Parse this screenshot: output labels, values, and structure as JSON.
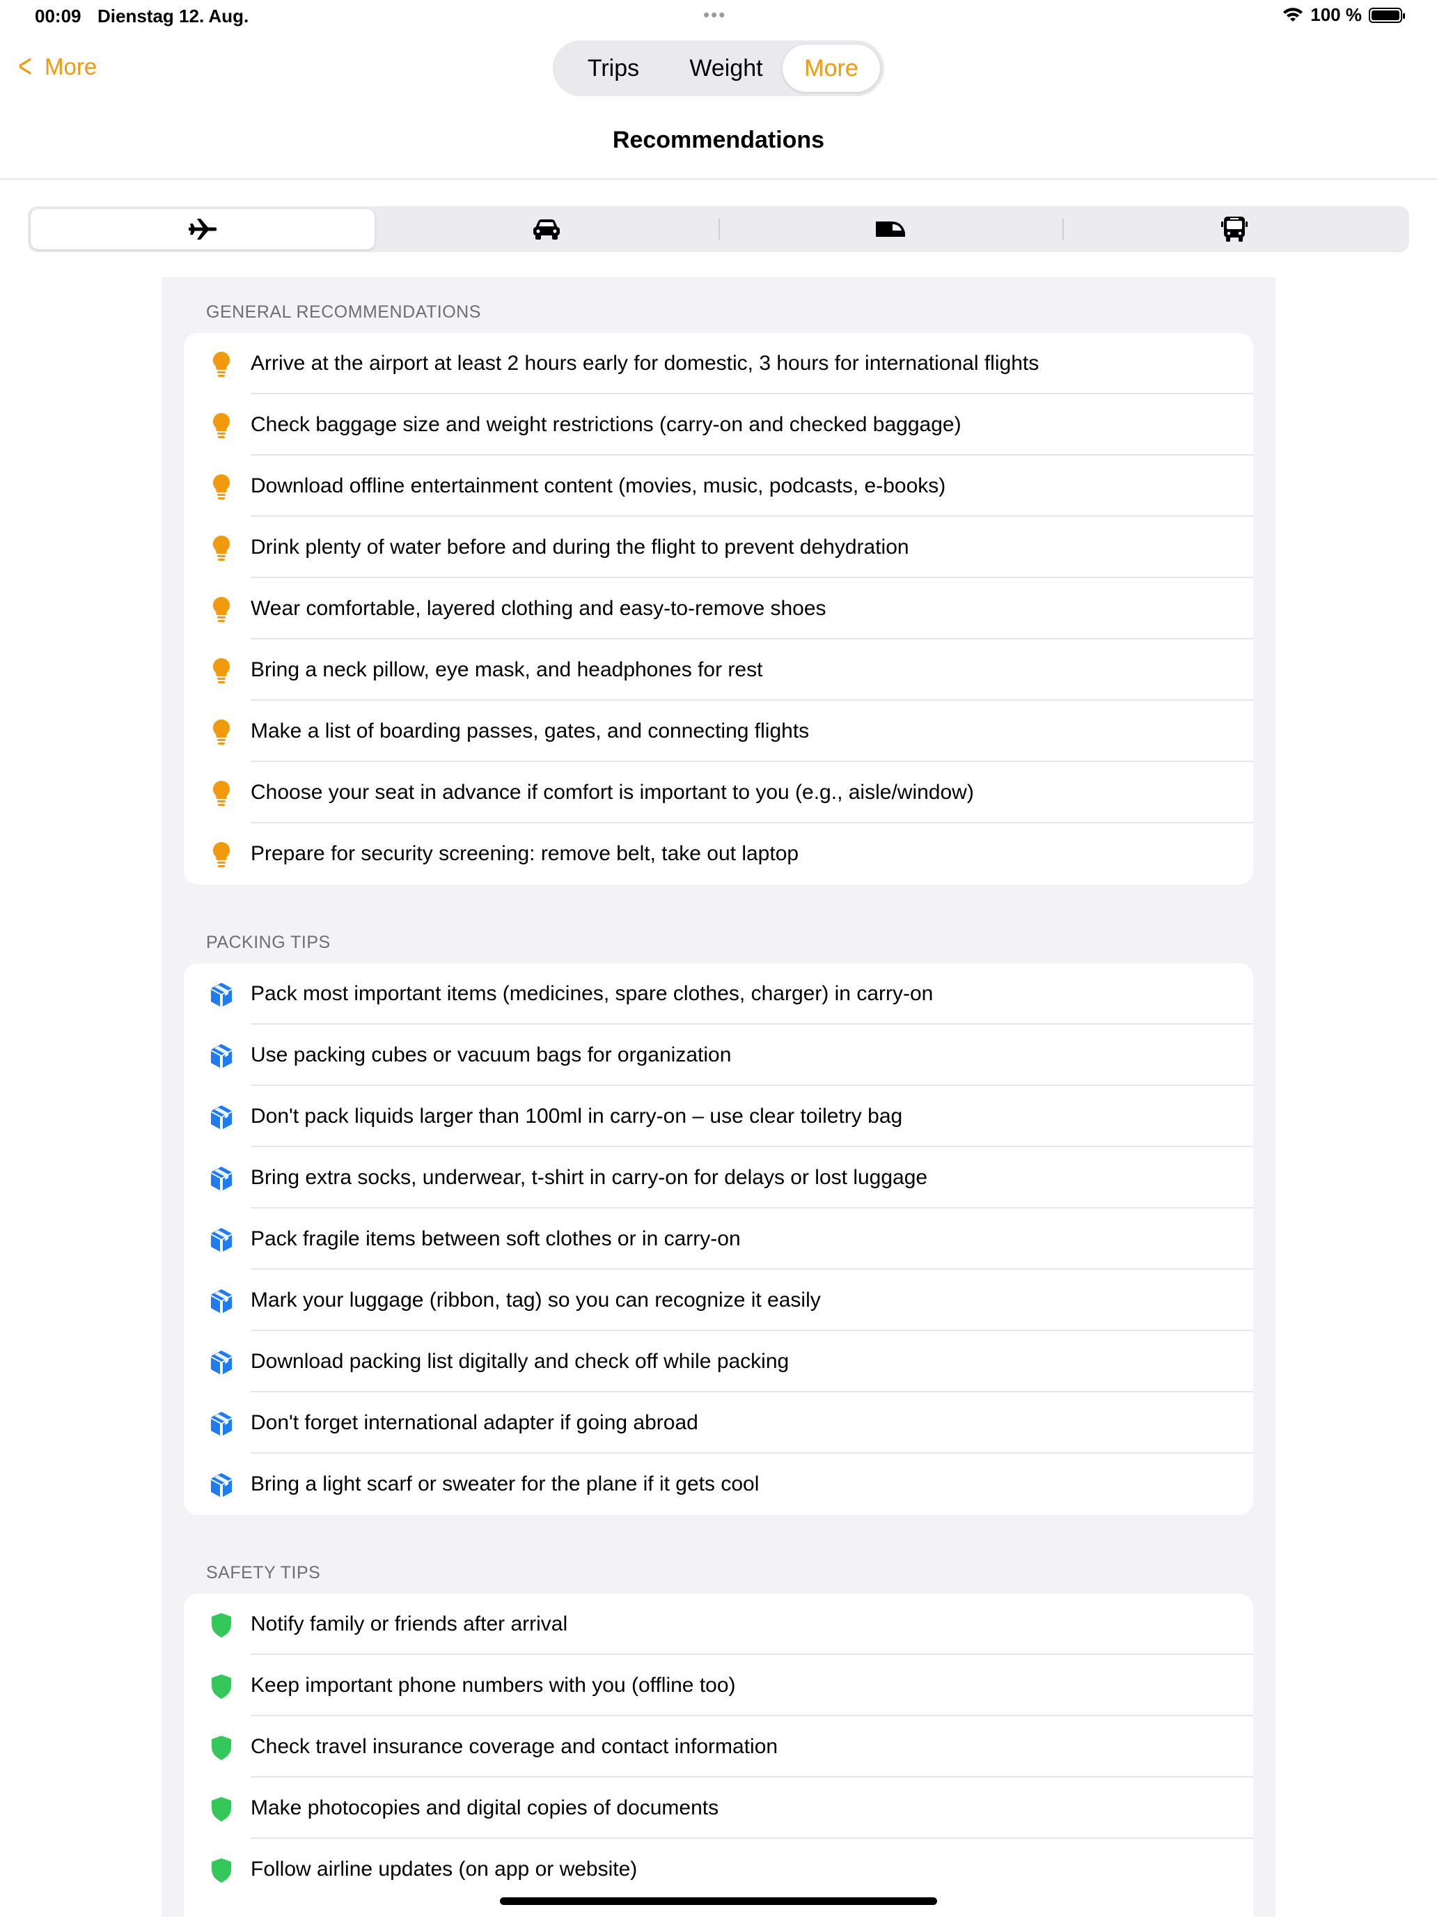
{
  "status_bar": {
    "time": "00:09",
    "date": "Dienstag 12. Aug.",
    "battery": "100 %"
  },
  "nav": {
    "back_label": "More",
    "segments": [
      "Trips",
      "Weight",
      "More"
    ],
    "active_segment": "More",
    "title": "Recommendations"
  },
  "transport_tabs": [
    {
      "icon": "airplane-icon",
      "active": true
    },
    {
      "icon": "car-icon",
      "active": false
    },
    {
      "icon": "train-icon",
      "active": false
    },
    {
      "icon": "bus-icon",
      "active": false
    }
  ],
  "colors": {
    "accent": "#f29a0e",
    "packing_icon": "#1e7cf0",
    "safety_icon": "#34c759"
  },
  "sections": [
    {
      "header": "GENERAL RECOMMENDATIONS",
      "icon": "lightbulb-icon",
      "items": [
        "Arrive at the airport at least 2 hours early for domestic, 3 hours for international flights",
        "Check baggage size and weight restrictions (carry-on and checked baggage)",
        "Download offline entertainment content (movies, music, podcasts, e-books)",
        "Drink plenty of water before and during the flight to prevent dehydration",
        "Wear comfortable, layered clothing and easy-to-remove shoes",
        "Bring a neck pillow, eye mask, and headphones for rest",
        "Make a list of boarding passes, gates, and connecting flights",
        "Choose your seat in advance if comfort is important to you (e.g., aisle/window)",
        "Prepare for security screening: remove belt, take out laptop"
      ]
    },
    {
      "header": "PACKING TIPS",
      "icon": "cube-icon",
      "items": [
        "Pack most important items (medicines, spare clothes, charger) in carry-on",
        "Use packing cubes or vacuum bags for organization",
        "Don't pack liquids larger than 100ml in carry-on – use clear toiletry bag",
        "Bring extra socks, underwear, t-shirt in carry-on for delays or lost luggage",
        "Pack fragile items between soft clothes or in carry-on",
        "Mark your luggage (ribbon, tag) so you can recognize it easily",
        "Download packing list digitally and check off while packing",
        "Don't forget international adapter if going abroad",
        "Bring a light scarf or sweater for the plane if it gets cool"
      ]
    },
    {
      "header": "SAFETY TIPS",
      "icon": "shield-icon",
      "items": [
        "Notify family or friends after arrival",
        "Keep important phone numbers with you (offline too)",
        "Check travel insurance coverage and contact information",
        "Make photocopies and digital copies of documents",
        "Follow airline updates (on app or website)"
      ]
    }
  ]
}
